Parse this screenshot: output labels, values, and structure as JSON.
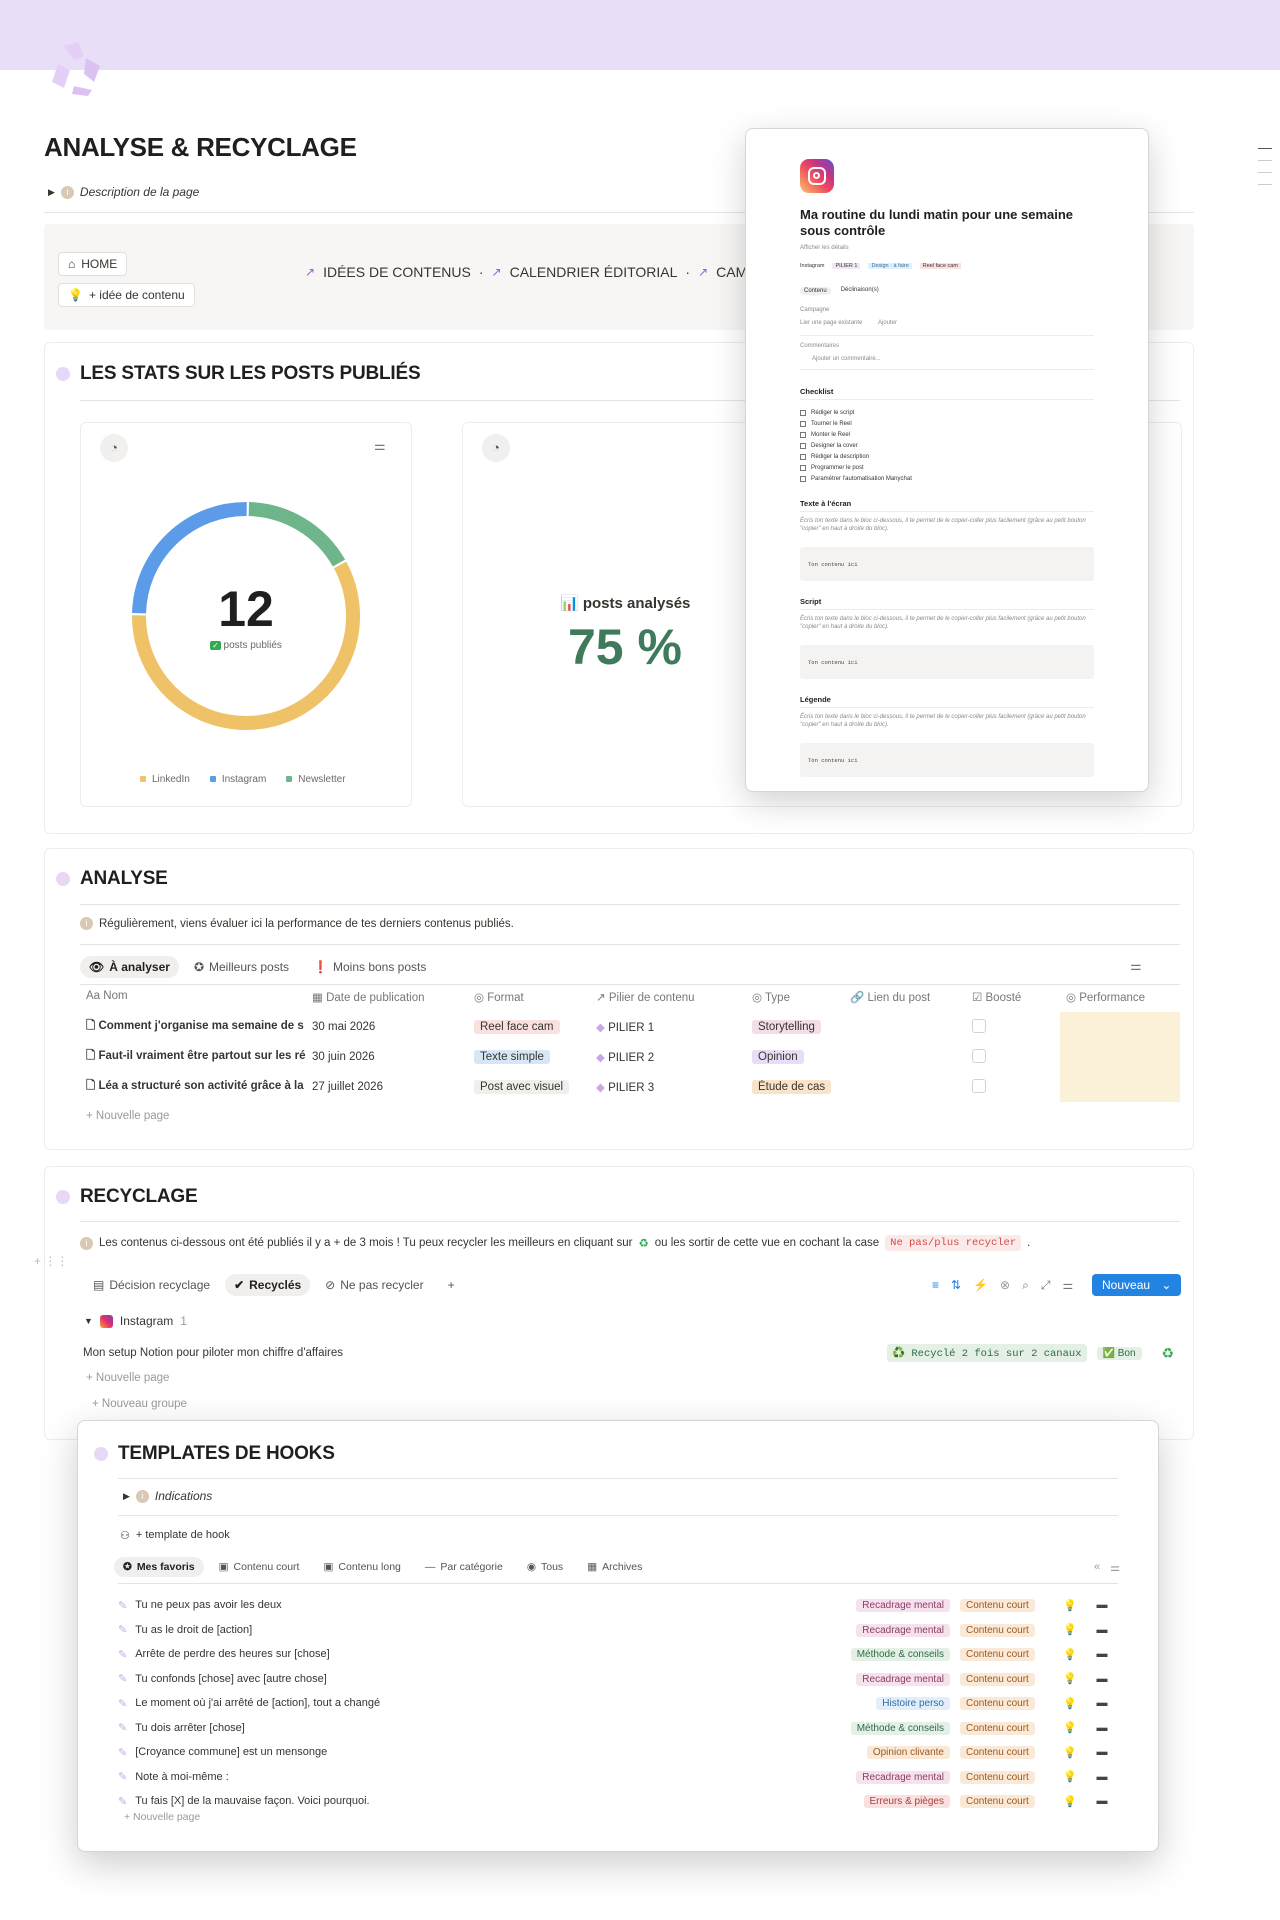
{
  "page": {
    "title": "ANALYSE & RECYCLAGE",
    "description_toggle": "Description de la page"
  },
  "nav": {
    "home": "HOME",
    "add_idea": "+ idée de contenu",
    "links": [
      "IDÉES DE CONTENUS",
      "CALENDRIER ÉDITORIAL",
      "CAMP"
    ],
    "separator": "·"
  },
  "stats": {
    "title": "LES STATS SUR LES POSTS PUBLIÉS",
    "donut_value": "12",
    "donut_label": "posts publiés",
    "analysed_label": "📊 posts analysés",
    "analysed_value": "75 %",
    "legend": [
      "LinkedIn",
      "Instagram",
      "Newsletter"
    ],
    "colors": {
      "linkedin": "#efc268",
      "instagram": "#5b9be8",
      "newsletter": "#6fb58c"
    }
  },
  "chart_data": {
    "type": "pie",
    "categories": [
      "LinkedIn",
      "Instagram",
      "Newsletter"
    ],
    "values": [
      7,
      3,
      2
    ],
    "total": 12
  },
  "analyse": {
    "title": "ANALYSE",
    "info": "Régulièrement, viens évaluer ici la performance de tes derniers contenus publiés.",
    "tabs": [
      "À analyser",
      "Meilleurs posts",
      "Moins bons posts"
    ],
    "columns": [
      "Nom",
      "Date de publication",
      "Format",
      "Pilier de contenu",
      "Type",
      "Lien du post",
      "Boosté",
      "Performance"
    ],
    "rows": [
      {
        "name": "Comment j'organise ma semaine de s",
        "date": "30 mai 2026",
        "format": "Reel face cam",
        "pilier": "PILIER 1",
        "type": "Storytelling"
      },
      {
        "name": "Faut-il vraiment être partout sur les ré",
        "date": "30 juin 2026",
        "format": "Texte simple",
        "pilier": "PILIER 2",
        "type": "Opinion"
      },
      {
        "name": "Léa a structuré son activité grâce à la",
        "date": "27 juillet 2026",
        "format": "Post avec visuel",
        "pilier": "PILIER 3",
        "type": "Étude de cas"
      }
    ],
    "new_page": "+ Nouvelle page"
  },
  "recyclage": {
    "title": "RECYCLAGE",
    "info_before": "Les contenus ci-dessous ont été publiés il y a + de 3 mois ! Tu peux recycler les meilleurs en cliquant sur",
    "info_middle": "ou les sortir de cette vue en cochant la case",
    "info_code": "Ne pas/plus recycler",
    "info_end": ".",
    "tabs": [
      "Décision recyclage",
      "Recyclés",
      "Ne pas recycler"
    ],
    "new_button": "Nouveau",
    "group": {
      "name": "Instagram",
      "count": "1"
    },
    "row": {
      "name": "Mon setup Notion pour piloter mon chiffre d'affaires",
      "recycled": "♻️ Recyclé 2 fois sur 2 canaux",
      "rating": "✅ Bon"
    },
    "new_page": "+ Nouvelle page",
    "new_group": "+ Nouveau groupe"
  },
  "popup": {
    "title": "Ma routine du lundi matin pour une semaine sous contrôle",
    "subtitle": "Afficher les détails",
    "tags": [
      "Instagram",
      "PILIER 1",
      "Design · à faire",
      "Reel face cam"
    ],
    "tabs": [
      "Contenu",
      "Déclinaison(s)"
    ],
    "campaign": "Campagne",
    "link_page": "Lier une page existante",
    "add": "Ajouter",
    "comments": "Commentaires",
    "comment_placeholder": "Ajouter un commentaire...",
    "checklist_title": "Checklist",
    "checklist": [
      "Rédiger le script",
      "Tourner le Reel",
      "Monter le Reel",
      "Designer la cover",
      "Rédiger la description",
      "Programmer le post",
      "Paramétrer l'automatisation Manychat"
    ],
    "sections": [
      {
        "title": "Texte à l'écran",
        "hint": "Écris ton texte dans le bloc ci-dessous, il te permet de le copier-coller plus facilement (grâce au petit bouton \"copier\" en haut à droite du bloc).",
        "code": "Ton contenu ici"
      },
      {
        "title": "Script",
        "hint": "Écris ton texte dans le bloc ci-dessous, il te permet de le copier-coller plus facilement (grâce au petit bouton \"copier\" en haut à droite du bloc).",
        "code": "Ton contenu ici"
      },
      {
        "title": "Légende",
        "hint": "Écris ton texte dans le bloc ci-dessous, il te permet de le copier-coller plus facilement (grâce au petit bouton \"copier\" en haut à droite du bloc).",
        "code": "Ton contenu ici"
      }
    ]
  },
  "hooks": {
    "title": "TEMPLATES DE HOOKS",
    "indications": "Indications",
    "add_template": "+ template de hook",
    "tabs": [
      "Mes favoris",
      "Contenu court",
      "Contenu long",
      "Par catégorie",
      "Tous",
      "Archives"
    ],
    "rows": [
      {
        "name": "Tu ne peux pas avoir les deux",
        "cat": "Recadrage mental",
        "len": "Contenu court"
      },
      {
        "name": "Tu as le droit de [action]",
        "cat": "Recadrage mental",
        "len": "Contenu court"
      },
      {
        "name": "Arrête de perdre des heures sur [chose]",
        "cat": "Méthode & conseils",
        "len": "Contenu court"
      },
      {
        "name": "Tu confonds [chose] avec [autre chose]",
        "cat": "Recadrage mental",
        "len": "Contenu court"
      },
      {
        "name": "Le moment où j'ai arrêté de [action], tout a changé",
        "cat": "Histoire perso",
        "len": "Contenu court"
      },
      {
        "name": "Tu dois arrêter [chose]",
        "cat": "Méthode & conseils",
        "len": "Contenu court"
      },
      {
        "name": "[Croyance commune] est un mensonge",
        "cat": "Opinion clivante",
        "len": "Contenu court"
      },
      {
        "name": "Note à moi-même :",
        "cat": "Recadrage mental",
        "len": "Contenu court"
      },
      {
        "name": "Tu fais [X] de la mauvaise façon. Voici pourquoi.",
        "cat": "Erreurs & pièges",
        "len": "Contenu court"
      }
    ],
    "new_page": "+ Nouvelle page"
  }
}
